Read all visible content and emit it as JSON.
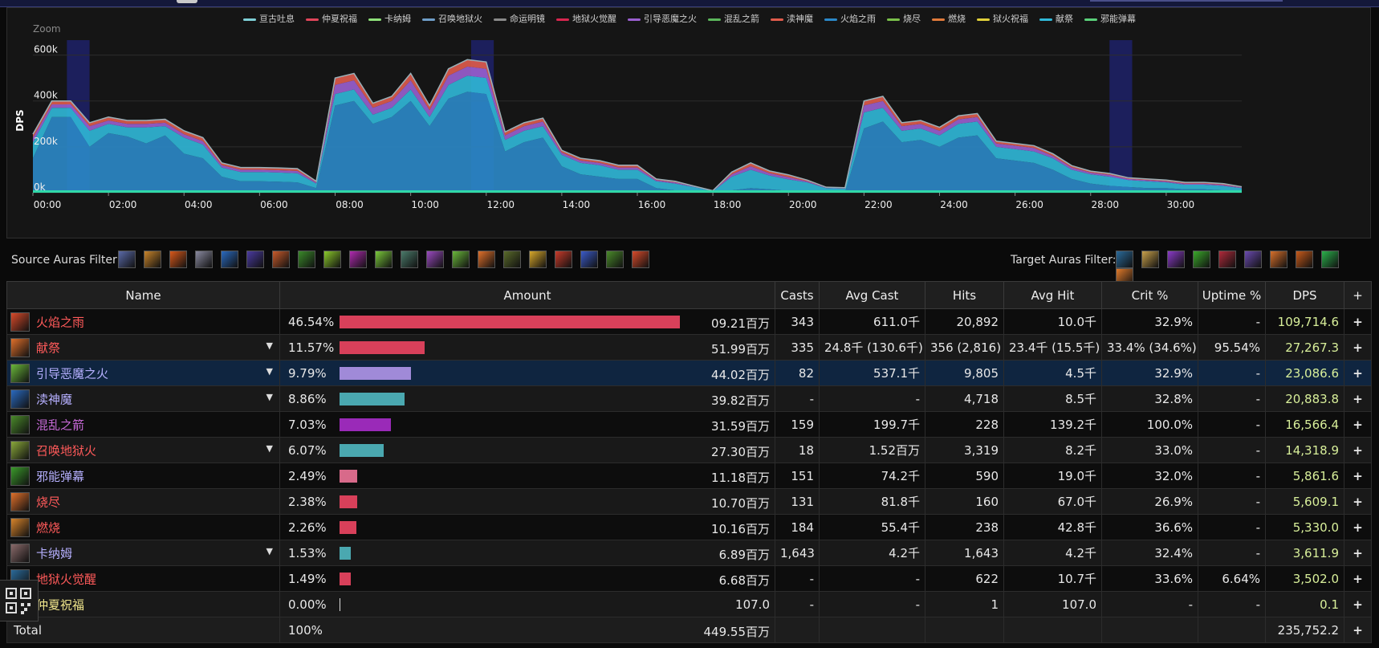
{
  "chart": {
    "zoom_label": "Zoom",
    "y_axis_label": "DPS",
    "y_ticks": [
      "0k",
      "200k",
      "400k",
      "600k"
    ],
    "x_ticks": [
      "00:00",
      "02:00",
      "04:00",
      "06:00",
      "08:00",
      "10:00",
      "12:00",
      "14:00",
      "16:00",
      "18:00",
      "20:00",
      "22:00",
      "24:00",
      "26:00",
      "28:00",
      "30:00"
    ],
    "legend": [
      {
        "label": "亘古吐息",
        "color": "#7ecfd6"
      },
      {
        "label": "仲夏祝福",
        "color": "#e0455a"
      },
      {
        "label": "卡纳姆",
        "color": "#8ee07a"
      },
      {
        "label": "召唤地狱火",
        "color": "#6f9ec8"
      },
      {
        "label": "命运明镜",
        "color": "#8a8a8a"
      },
      {
        "label": "地狱火觉醒",
        "color": "#d8264f"
      },
      {
        "label": "引导恶魔之火",
        "color": "#9a5fd0"
      },
      {
        "label": "混乱之箭",
        "color": "#5bb65b"
      },
      {
        "label": "渎神魔",
        "color": "#e05b4b"
      },
      {
        "label": "火焰之雨",
        "color": "#2b88c8"
      },
      {
        "label": "烧尽",
        "color": "#7ac04a"
      },
      {
        "label": "燃烧",
        "color": "#e07a3a"
      },
      {
        "label": "狱火祝福",
        "color": "#e0d03a"
      },
      {
        "label": "献祭",
        "color": "#30b8d8"
      },
      {
        "label": "邪能弹幕",
        "color": "#5ad07a"
      }
    ]
  },
  "chart_data": {
    "type": "area",
    "x_unit": "minutes",
    "xlim": [
      0,
      32
    ],
    "ylim": [
      0,
      700000
    ],
    "x": [
      0,
      0.5,
      1,
      1.5,
      2,
      2.5,
      3,
      3.5,
      4,
      4.5,
      5,
      5.5,
      6,
      6.5,
      7,
      7.5,
      8,
      8.5,
      9,
      9.5,
      10,
      10.5,
      11,
      11.5,
      12,
      12.5,
      13,
      13.5,
      14,
      14.5,
      15,
      15.5,
      16,
      16.5,
      17,
      17.5,
      18,
      18.5,
      19,
      19.5,
      20,
      20.5,
      21,
      21.5,
      22,
      22.5,
      23,
      23.5,
      24,
      24.5,
      25,
      25.5,
      26,
      26.5,
      27,
      27.5,
      28,
      28.5,
      29,
      29.5,
      30,
      30.5,
      31,
      31.5,
      32
    ],
    "series": [
      {
        "name": "火焰之雨",
        "values": [
          150000,
          330000,
          330000,
          200000,
          260000,
          245000,
          215000,
          250000,
          170000,
          150000,
          70000,
          50000,
          50000,
          48000,
          45000,
          20000,
          380000,
          400000,
          300000,
          330000,
          400000,
          290000,
          410000,
          440000,
          430000,
          180000,
          220000,
          240000,
          115000,
          80000,
          70000,
          60000,
          60000,
          20000,
          10000,
          5000,
          2000,
          10000,
          20000,
          15000,
          8000,
          5000,
          0,
          3000,
          280000,
          310000,
          220000,
          230000,
          200000,
          240000,
          250000,
          150000,
          140000,
          130000,
          100000,
          60000,
          40000,
          30000,
          25000,
          20000,
          20000,
          15000,
          15000,
          10000,
          5000
        ]
      },
      {
        "name": "献祭",
        "values": [
          70000,
          40000,
          40000,
          70000,
          40000,
          40000,
          70000,
          40000,
          70000,
          60000,
          40000,
          40000,
          40000,
          40000,
          40000,
          20000,
          50000,
          50000,
          40000,
          40000,
          50000,
          40000,
          60000,
          70000,
          70000,
          50000,
          50000,
          50000,
          50000,
          50000,
          50000,
          40000,
          40000,
          30000,
          30000,
          20000,
          5000,
          60000,
          80000,
          60000,
          50000,
          40000,
          20000,
          15000,
          70000,
          60000,
          50000,
          50000,
          50000,
          60000,
          60000,
          50000,
          50000,
          50000,
          50000,
          40000,
          40000,
          40000,
          30000,
          30000,
          25000,
          20000,
          20000,
          20000,
          15000
        ]
      },
      {
        "name": "引导恶魔之火",
        "values": [
          20000,
          15000,
          15000,
          20000,
          15000,
          15000,
          15000,
          15000,
          15000,
          15000,
          10000,
          10000,
          10000,
          10000,
          10000,
          5000,
          40000,
          40000,
          30000,
          30000,
          40000,
          30000,
          40000,
          40000,
          40000,
          20000,
          20000,
          20000,
          10000,
          10000,
          10000,
          10000,
          10000,
          5000,
          5000,
          2000,
          1000,
          10000,
          15000,
          10000,
          10000,
          5000,
          2000,
          2000,
          30000,
          30000,
          20000,
          20000,
          20000,
          20000,
          20000,
          15000,
          15000,
          15000,
          10000,
          10000,
          8000,
          8000,
          5000,
          5000,
          5000,
          5000,
          5000,
          5000,
          3000
        ]
      },
      {
        "name": "渎神魔",
        "values": [
          15000,
          15000,
          15000,
          15000,
          15000,
          15000,
          15000,
          15000,
          15000,
          15000,
          10000,
          10000,
          10000,
          10000,
          10000,
          5000,
          30000,
          30000,
          20000,
          20000,
          30000,
          20000,
          30000,
          30000,
          30000,
          15000,
          15000,
          15000,
          10000,
          10000,
          10000,
          10000,
          10000,
          5000,
          5000,
          2000,
          1000,
          10000,
          15000,
          10000,
          10000,
          5000,
          2000,
          2000,
          20000,
          20000,
          15000,
          15000,
          15000,
          15000,
          15000,
          10000,
          10000,
          10000,
          10000,
          8000,
          6000,
          6000,
          5000,
          5000,
          5000,
          5000,
          5000,
          5000,
          3000
        ]
      }
    ]
  },
  "filters": {
    "source_label": "Source Auras Filter:",
    "target_label": "Target Auras Filter:",
    "source_icons": [
      {
        "name": "aura-icon",
        "color": "#5a6aa8"
      },
      {
        "name": "aura-icon",
        "color": "#c8842a"
      },
      {
        "name": "aura-icon",
        "color": "#d8581a"
      },
      {
        "name": "aura-icon",
        "color": "#8a8aa0"
      },
      {
        "name": "aura-icon",
        "color": "#2a6ac0"
      },
      {
        "name": "aura-icon",
        "color": "#4a3aa0"
      },
      {
        "name": "aura-icon",
        "color": "#c85a2a"
      },
      {
        "name": "aura-icon",
        "color": "#3a8a2a"
      },
      {
        "name": "aura-icon",
        "color": "#8ac82a"
      },
      {
        "name": "aura-icon",
        "color": "#b02ab0"
      },
      {
        "name": "aura-icon",
        "color": "#7ac83a"
      },
      {
        "name": "aura-icon",
        "color": "#4a7a6a"
      },
      {
        "name": "aura-icon",
        "color": "#9a4ac0"
      },
      {
        "name": "aura-icon",
        "color": "#6ab83a"
      },
      {
        "name": "aura-icon",
        "color": "#e0702a"
      },
      {
        "name": "aura-icon",
        "color": "#5a6a2a"
      },
      {
        "name": "aura-icon",
        "color": "#d8a82a"
      },
      {
        "name": "aura-icon",
        "color": "#c83a2a"
      },
      {
        "name": "aura-icon",
        "color": "#3a5ac8"
      },
      {
        "name": "aura-icon",
        "color": "#4a8a2a"
      },
      {
        "name": "aura-icon",
        "color": "#d84a2a"
      }
    ],
    "target_icons": [
      {
        "name": "aura-icon",
        "color": "#2a6a9a"
      },
      {
        "name": "aura-icon",
        "color": "#c8a04a"
      },
      {
        "name": "aura-icon",
        "color": "#8a3ac8"
      },
      {
        "name": "aura-icon",
        "color": "#3aa82a"
      },
      {
        "name": "aura-icon",
        "color": "#b02a3a"
      },
      {
        "name": "aura-icon",
        "color": "#6a4ab0"
      },
      {
        "name": "aura-icon",
        "color": "#d8702a"
      },
      {
        "name": "aura-icon",
        "color": "#c85a1a"
      },
      {
        "name": "aura-icon",
        "color": "#2ab04a"
      },
      {
        "name": "aura-icon",
        "color": "#e07a2a"
      }
    ]
  },
  "table": {
    "headers": [
      "Name",
      "Amount",
      "Casts",
      "Avg Cast",
      "Hits",
      "Avg Hit",
      "Crit %",
      "Uptime %",
      "DPS",
      "+"
    ],
    "rows": [
      {
        "name": "火焰之雨",
        "name_color": "#ff5a5a",
        "icon_color": "#d84a2a",
        "caret": false,
        "pct": "46.54%",
        "bar_pct": 100,
        "bar_color": "#d8405a",
        "amount": "09.21百万",
        "casts": "343",
        "avg_cast": "611.0千",
        "hits": "20,892",
        "avg_hit": "10.0千",
        "crit": "32.9%",
        "uptime": "-",
        "dps": "109,714.6",
        "plus": "+"
      },
      {
        "name": "献祭",
        "name_color": "#ff5a5a",
        "icon_color": "#e0702a",
        "caret": true,
        "pct": "11.57%",
        "bar_pct": 24.9,
        "bar_color": "#d8405a",
        "amount": "51.99百万",
        "casts": "335",
        "avg_cast": "24.8千 (130.6千)",
        "hits": "356 (2,816)",
        "avg_hit": "23.4千 (15.5千)",
        "crit": "33.4% (34.6%)",
        "uptime": "95.54%",
        "dps": "27,267.3",
        "plus": "+"
      },
      {
        "name": "引导恶魔之火",
        "name_color": "#b6b0ff",
        "icon_color": "#6ab83a",
        "caret": true,
        "pct": "9.79%",
        "bar_pct": 21.0,
        "bar_color": "#a08ad8",
        "amount": "44.02百万",
        "casts": "82",
        "avg_cast": "537.1千",
        "hits": "9,805",
        "avg_hit": "4.5千",
        "crit": "32.9%",
        "uptime": "-",
        "dps": "23,086.6",
        "plus": "+"
      },
      {
        "name": "渎神魔",
        "name_color": "#b6b0ff",
        "icon_color": "#2a6ac0",
        "caret": true,
        "pct": "8.86%",
        "bar_pct": 19.0,
        "bar_color": "#4aa8b0",
        "amount": "39.82百万",
        "casts": "-",
        "avg_cast": "-",
        "hits": "4,718",
        "avg_hit": "8.5千",
        "crit": "32.8%",
        "uptime": "-",
        "dps": "20,883.8",
        "plus": "+"
      },
      {
        "name": "混乱之箭",
        "name_color": "#c86ad8",
        "icon_color": "#4a8a2a",
        "caret": false,
        "pct": "7.03%",
        "bar_pct": 15.1,
        "bar_color": "#9a2ab8",
        "amount": "31.59百万",
        "casts": "159",
        "avg_cast": "199.7千",
        "hits": "228",
        "avg_hit": "139.2千",
        "crit": "100.0%",
        "uptime": "-",
        "dps": "16,566.4",
        "plus": "+"
      },
      {
        "name": "召唤地狱火",
        "name_color": "#ff5a5a",
        "icon_color": "#8aa83a",
        "caret": true,
        "pct": "6.07%",
        "bar_pct": 13.0,
        "bar_color": "#4aa8b0",
        "amount": "27.30百万",
        "casts": "18",
        "avg_cast": "1.52百万",
        "hits": "3,319",
        "avg_hit": "8.2千",
        "crit": "33.0%",
        "uptime": "-",
        "dps": "14,318.9",
        "plus": "+"
      },
      {
        "name": "邪能弹幕",
        "name_color": "#b6b0ff",
        "icon_color": "#3a9a2a",
        "caret": false,
        "pct": "2.49%",
        "bar_pct": 5.3,
        "bar_color": "#d86a8a",
        "amount": "11.18百万",
        "casts": "151",
        "avg_cast": "74.2千",
        "hits": "590",
        "avg_hit": "19.0千",
        "crit": "32.0%",
        "uptime": "-",
        "dps": "5,861.6",
        "plus": "+"
      },
      {
        "name": "烧尽",
        "name_color": "#ff5a5a",
        "icon_color": "#e0702a",
        "caret": false,
        "pct": "2.38%",
        "bar_pct": 5.1,
        "bar_color": "#d8405a",
        "amount": "10.70百万",
        "casts": "131",
        "avg_cast": "81.8千",
        "hits": "160",
        "avg_hit": "67.0千",
        "crit": "26.9%",
        "uptime": "-",
        "dps": "5,609.1",
        "plus": "+"
      },
      {
        "name": "燃烧",
        "name_color": "#ff5a5a",
        "icon_color": "#d8842a",
        "caret": false,
        "pct": "2.26%",
        "bar_pct": 4.9,
        "bar_color": "#d8405a",
        "amount": "10.16百万",
        "casts": "184",
        "avg_cast": "55.4千",
        "hits": "238",
        "avg_hit": "42.8千",
        "crit": "36.6%",
        "uptime": "-",
        "dps": "5,330.0",
        "plus": "+"
      },
      {
        "name": "卡纳姆",
        "name_color": "#b6b0ff",
        "icon_color": "#8a6a6a",
        "caret": true,
        "pct": "1.53%",
        "bar_pct": 3.3,
        "bar_color": "#4aa8b0",
        "amount": "6.89百万",
        "casts": "1,643",
        "avg_cast": "4.2千",
        "hits": "1,643",
        "avg_hit": "4.2千",
        "crit": "32.4%",
        "uptime": "-",
        "dps": "3,611.9",
        "plus": "+"
      },
      {
        "name": "地狱火觉醒",
        "name_color": "#ff5a5a",
        "icon_color": "#2a6a9a",
        "caret": false,
        "pct": "1.49%",
        "bar_pct": 3.2,
        "bar_color": "#d8405a",
        "amount": "6.68百万",
        "casts": "-",
        "avg_cast": "-",
        "hits": "622",
        "avg_hit": "10.7千",
        "crit": "33.6%",
        "uptime": "6.64%",
        "dps": "3,502.0",
        "plus": "+"
      },
      {
        "name": "仲夏祝福",
        "name_color": "#f0e68c",
        "icon_color": "#c8a04a",
        "caret": false,
        "pct": "0.00%",
        "bar_pct": 0.2,
        "bar_color": "#dddddd",
        "amount": "107.0",
        "casts": "-",
        "avg_cast": "-",
        "hits": "1",
        "avg_hit": "107.0",
        "crit": "-",
        "uptime": "-",
        "dps": "0.1",
        "plus": "+"
      }
    ],
    "total": {
      "label": "Total",
      "pct": "100%",
      "amount": "449.55百万",
      "dps": "235,752.2",
      "plus": "+"
    }
  }
}
